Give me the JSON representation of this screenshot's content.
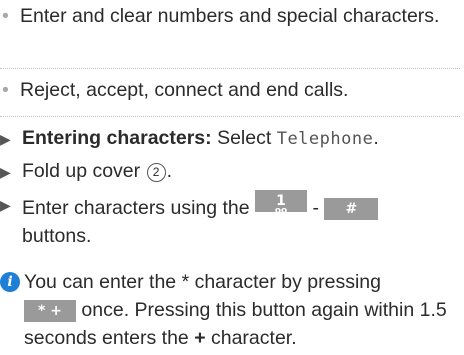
{
  "bullets": [
    "Enter and clear numbers and special characters.",
    "Reject, accept, connect and end calls."
  ],
  "steps": {
    "s1_bold": "Entering characters:",
    "s1_text": " Select ",
    "s1_code": "Telephone",
    "s1_end": ".",
    "s2_text": "Fold up cover ",
    "s2_num": "2",
    "s2_end": ".",
    "s3_pre": "Enter characters using the ",
    "s3_key1": "1",
    "s3_key1_sub": "oo",
    "s3_dash": " - ",
    "s3_key2": "#",
    "s3_post": "buttons."
  },
  "note": {
    "a": "You can enter the * character by pressing",
    "key": "* +",
    "b": " once. Pressing this button again within 1.5 seconds enters the ",
    "plus": "+",
    "c": " character."
  },
  "colors": {
    "info_icon": "#1f7fd6",
    "key_bg": "#9a9a9a",
    "text": "#2b2b2b"
  }
}
